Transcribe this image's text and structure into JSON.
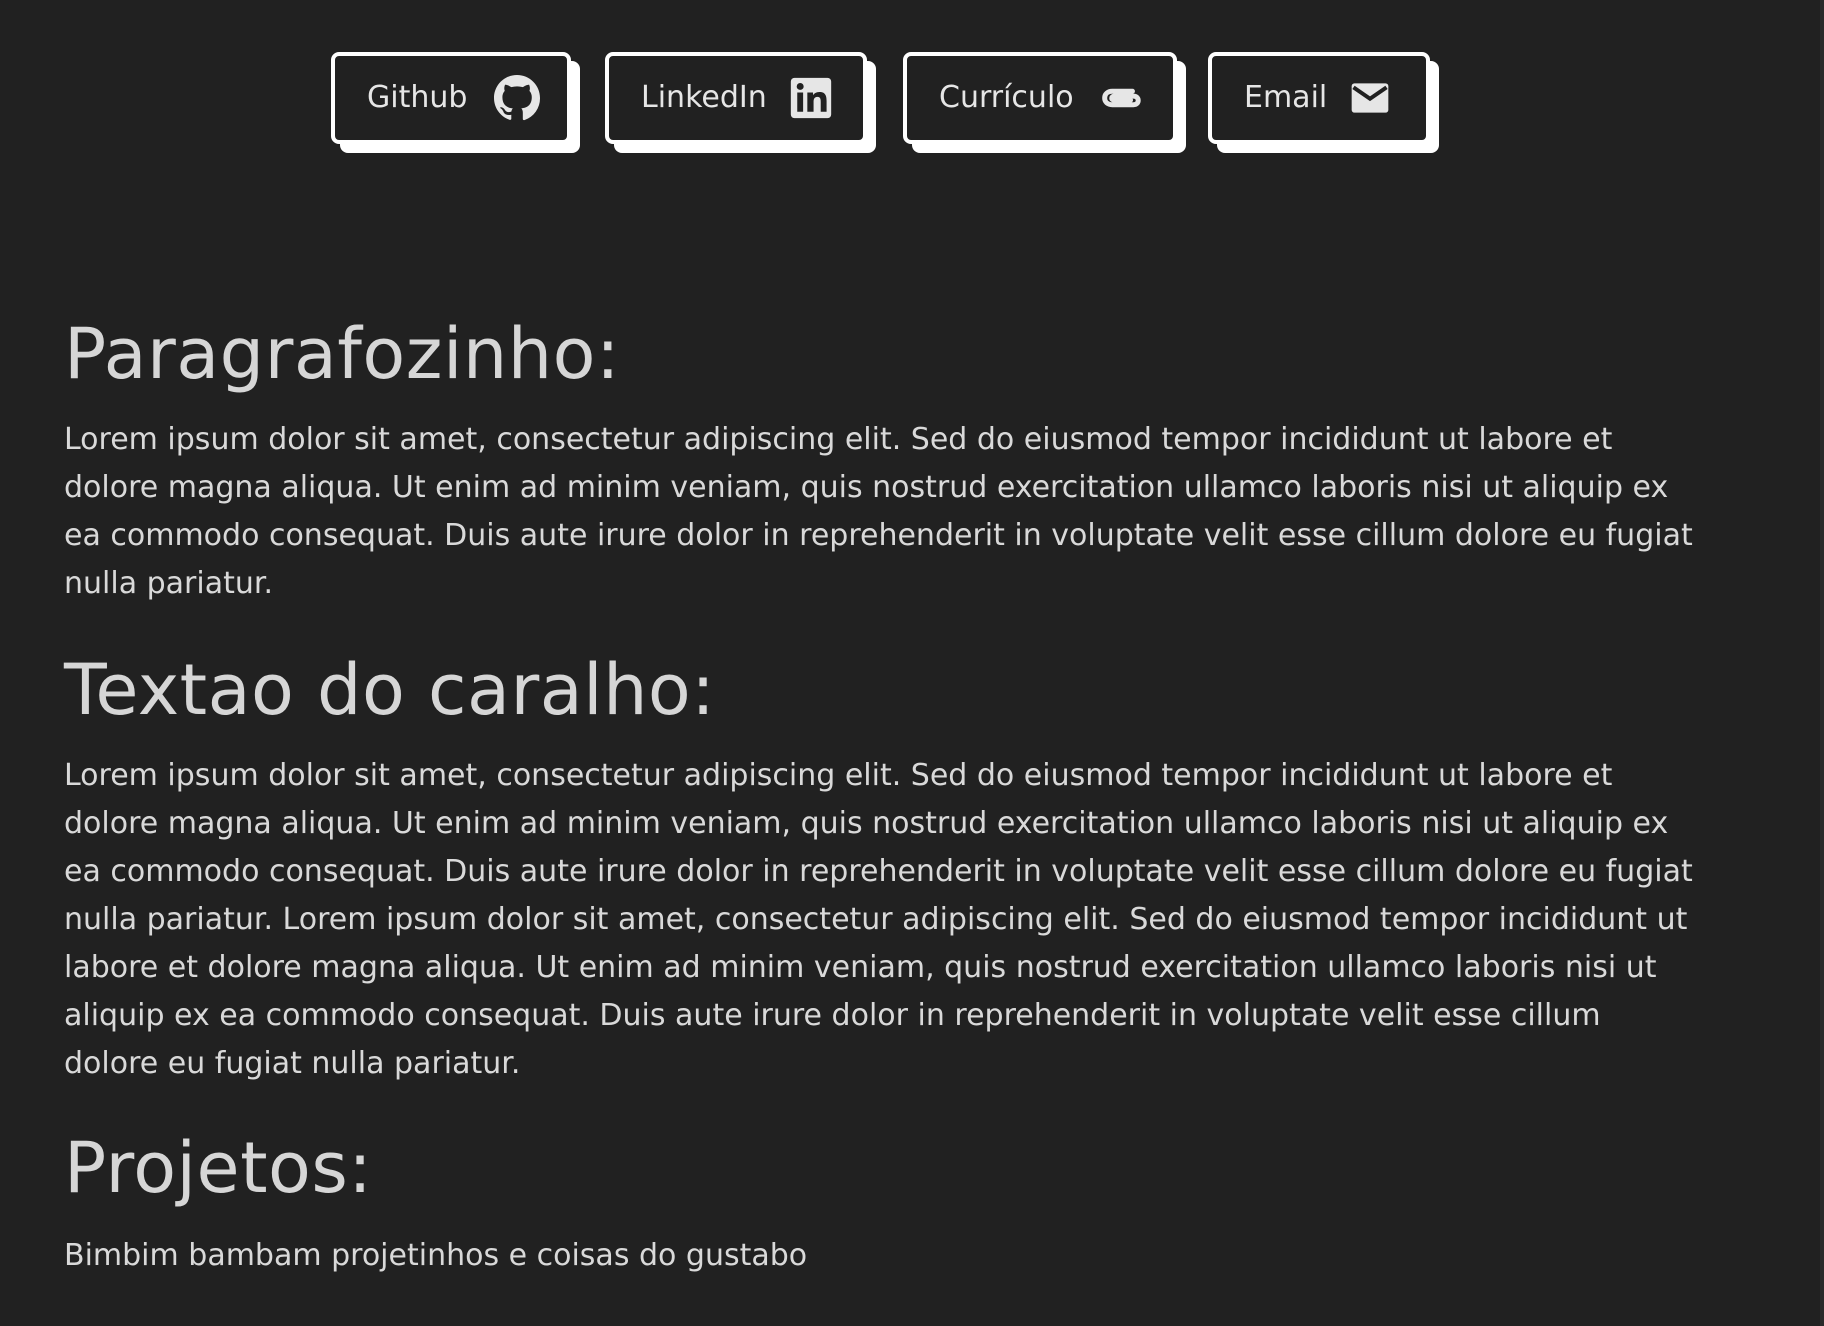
{
  "links": {
    "github": {
      "label": "Github",
      "icon": "github-icon"
    },
    "linkedin": {
      "label": "LinkedIn",
      "icon": "linkedin-icon"
    },
    "curriculo": {
      "label": "Currículo",
      "icon": "paperclip-icon"
    },
    "email": {
      "label": "Email",
      "icon": "mail-icon"
    }
  },
  "sections": {
    "paragrafo": {
      "title": "Paragrafozinho:",
      "body": "Lorem ipsum dolor sit amet, consectetur adipiscing elit. Sed do eiusmod tempor incididunt ut labore et dolore magna aliqua. Ut enim ad minim veniam, quis nostrud exercitation ullamco laboris nisi ut aliquip ex ea commodo consequat. Duis aute irure dolor in reprehenderit in voluptate velit esse cillum dolore eu fugiat nulla pariatur."
    },
    "textao": {
      "title": "Textao do caralho:",
      "body": "Lorem ipsum dolor sit amet, consectetur adipiscing elit. Sed do eiusmod tempor incididunt ut labore et dolore magna aliqua. Ut enim ad minim veniam, quis nostrud exercitation ullamco laboris nisi ut aliquip ex ea commodo consequat. Duis aute irure dolor in reprehenderit in voluptate velit esse cillum dolore eu fugiat nulla pariatur. Lorem ipsum dolor sit amet, consectetur adipiscing elit. Sed do eiusmod tempor incididunt ut labore et dolore magna aliqua. Ut enim ad minim veniam, quis nostrud exercitation ullamco laboris nisi ut aliquip ex ea commodo consequat. Duis aute irure dolor in reprehenderit in voluptate velit esse cillum dolore eu fugiat nulla pariatur."
    },
    "projetos": {
      "title": "Projetos:",
      "body": "Bimbim bambam projetinhos e coisas do gustabo"
    }
  },
  "colors": {
    "background": "#212121",
    "text": "#d9d9d9",
    "button_border": "#ffffff"
  }
}
